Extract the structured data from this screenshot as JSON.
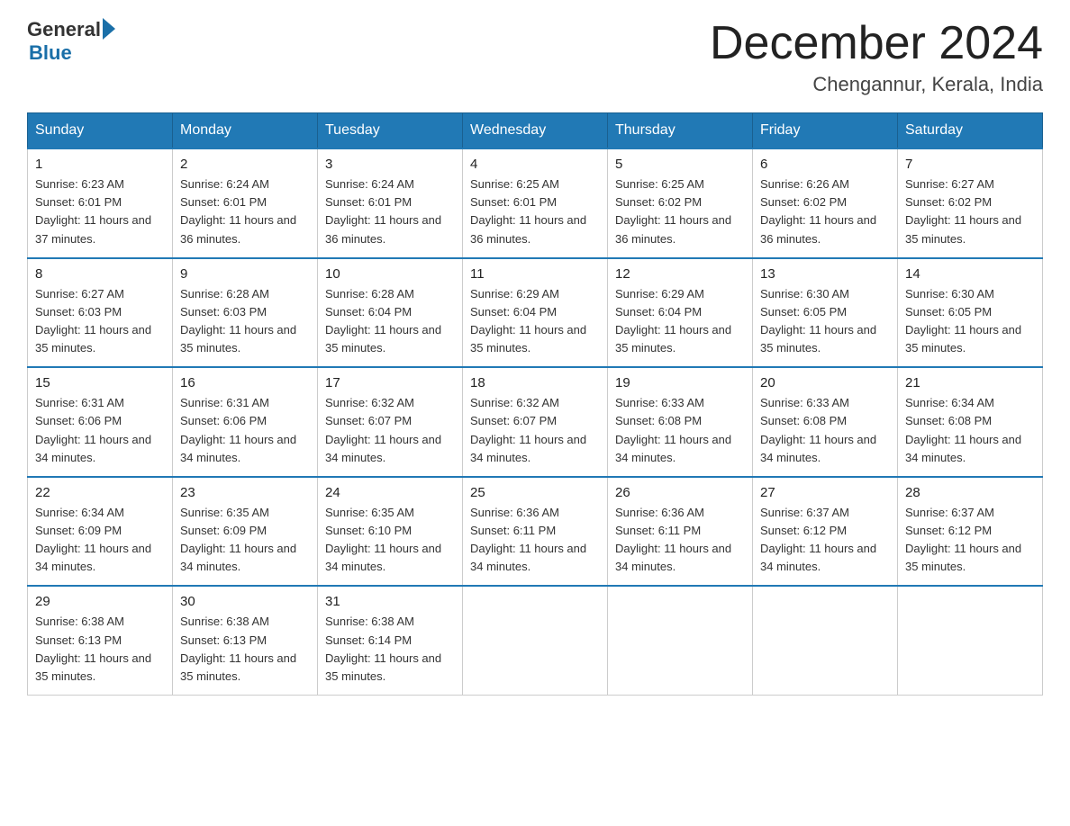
{
  "header": {
    "logo_general": "General",
    "logo_blue": "Blue",
    "month_title": "December 2024",
    "location": "Chengannur, Kerala, India"
  },
  "days_of_week": [
    "Sunday",
    "Monday",
    "Tuesday",
    "Wednesday",
    "Thursday",
    "Friday",
    "Saturday"
  ],
  "weeks": [
    [
      {
        "day": "1",
        "sunrise": "6:23 AM",
        "sunset": "6:01 PM",
        "daylight": "11 hours and 37 minutes."
      },
      {
        "day": "2",
        "sunrise": "6:24 AM",
        "sunset": "6:01 PM",
        "daylight": "11 hours and 36 minutes."
      },
      {
        "day": "3",
        "sunrise": "6:24 AM",
        "sunset": "6:01 PM",
        "daylight": "11 hours and 36 minutes."
      },
      {
        "day": "4",
        "sunrise": "6:25 AM",
        "sunset": "6:01 PM",
        "daylight": "11 hours and 36 minutes."
      },
      {
        "day": "5",
        "sunrise": "6:25 AM",
        "sunset": "6:02 PM",
        "daylight": "11 hours and 36 minutes."
      },
      {
        "day": "6",
        "sunrise": "6:26 AM",
        "sunset": "6:02 PM",
        "daylight": "11 hours and 36 minutes."
      },
      {
        "day": "7",
        "sunrise": "6:27 AM",
        "sunset": "6:02 PM",
        "daylight": "11 hours and 35 minutes."
      }
    ],
    [
      {
        "day": "8",
        "sunrise": "6:27 AM",
        "sunset": "6:03 PM",
        "daylight": "11 hours and 35 minutes."
      },
      {
        "day": "9",
        "sunrise": "6:28 AM",
        "sunset": "6:03 PM",
        "daylight": "11 hours and 35 minutes."
      },
      {
        "day": "10",
        "sunrise": "6:28 AM",
        "sunset": "6:04 PM",
        "daylight": "11 hours and 35 minutes."
      },
      {
        "day": "11",
        "sunrise": "6:29 AM",
        "sunset": "6:04 PM",
        "daylight": "11 hours and 35 minutes."
      },
      {
        "day": "12",
        "sunrise": "6:29 AM",
        "sunset": "6:04 PM",
        "daylight": "11 hours and 35 minutes."
      },
      {
        "day": "13",
        "sunrise": "6:30 AM",
        "sunset": "6:05 PM",
        "daylight": "11 hours and 35 minutes."
      },
      {
        "day": "14",
        "sunrise": "6:30 AM",
        "sunset": "6:05 PM",
        "daylight": "11 hours and 35 minutes."
      }
    ],
    [
      {
        "day": "15",
        "sunrise": "6:31 AM",
        "sunset": "6:06 PM",
        "daylight": "11 hours and 34 minutes."
      },
      {
        "day": "16",
        "sunrise": "6:31 AM",
        "sunset": "6:06 PM",
        "daylight": "11 hours and 34 minutes."
      },
      {
        "day": "17",
        "sunrise": "6:32 AM",
        "sunset": "6:07 PM",
        "daylight": "11 hours and 34 minutes."
      },
      {
        "day": "18",
        "sunrise": "6:32 AM",
        "sunset": "6:07 PM",
        "daylight": "11 hours and 34 minutes."
      },
      {
        "day": "19",
        "sunrise": "6:33 AM",
        "sunset": "6:08 PM",
        "daylight": "11 hours and 34 minutes."
      },
      {
        "day": "20",
        "sunrise": "6:33 AM",
        "sunset": "6:08 PM",
        "daylight": "11 hours and 34 minutes."
      },
      {
        "day": "21",
        "sunrise": "6:34 AM",
        "sunset": "6:08 PM",
        "daylight": "11 hours and 34 minutes."
      }
    ],
    [
      {
        "day": "22",
        "sunrise": "6:34 AM",
        "sunset": "6:09 PM",
        "daylight": "11 hours and 34 minutes."
      },
      {
        "day": "23",
        "sunrise": "6:35 AM",
        "sunset": "6:09 PM",
        "daylight": "11 hours and 34 minutes."
      },
      {
        "day": "24",
        "sunrise": "6:35 AM",
        "sunset": "6:10 PM",
        "daylight": "11 hours and 34 minutes."
      },
      {
        "day": "25",
        "sunrise": "6:36 AM",
        "sunset": "6:11 PM",
        "daylight": "11 hours and 34 minutes."
      },
      {
        "day": "26",
        "sunrise": "6:36 AM",
        "sunset": "6:11 PM",
        "daylight": "11 hours and 34 minutes."
      },
      {
        "day": "27",
        "sunrise": "6:37 AM",
        "sunset": "6:12 PM",
        "daylight": "11 hours and 34 minutes."
      },
      {
        "day": "28",
        "sunrise": "6:37 AM",
        "sunset": "6:12 PM",
        "daylight": "11 hours and 35 minutes."
      }
    ],
    [
      {
        "day": "29",
        "sunrise": "6:38 AM",
        "sunset": "6:13 PM",
        "daylight": "11 hours and 35 minutes."
      },
      {
        "day": "30",
        "sunrise": "6:38 AM",
        "sunset": "6:13 PM",
        "daylight": "11 hours and 35 minutes."
      },
      {
        "day": "31",
        "sunrise": "6:38 AM",
        "sunset": "6:14 PM",
        "daylight": "11 hours and 35 minutes."
      },
      null,
      null,
      null,
      null
    ]
  ]
}
